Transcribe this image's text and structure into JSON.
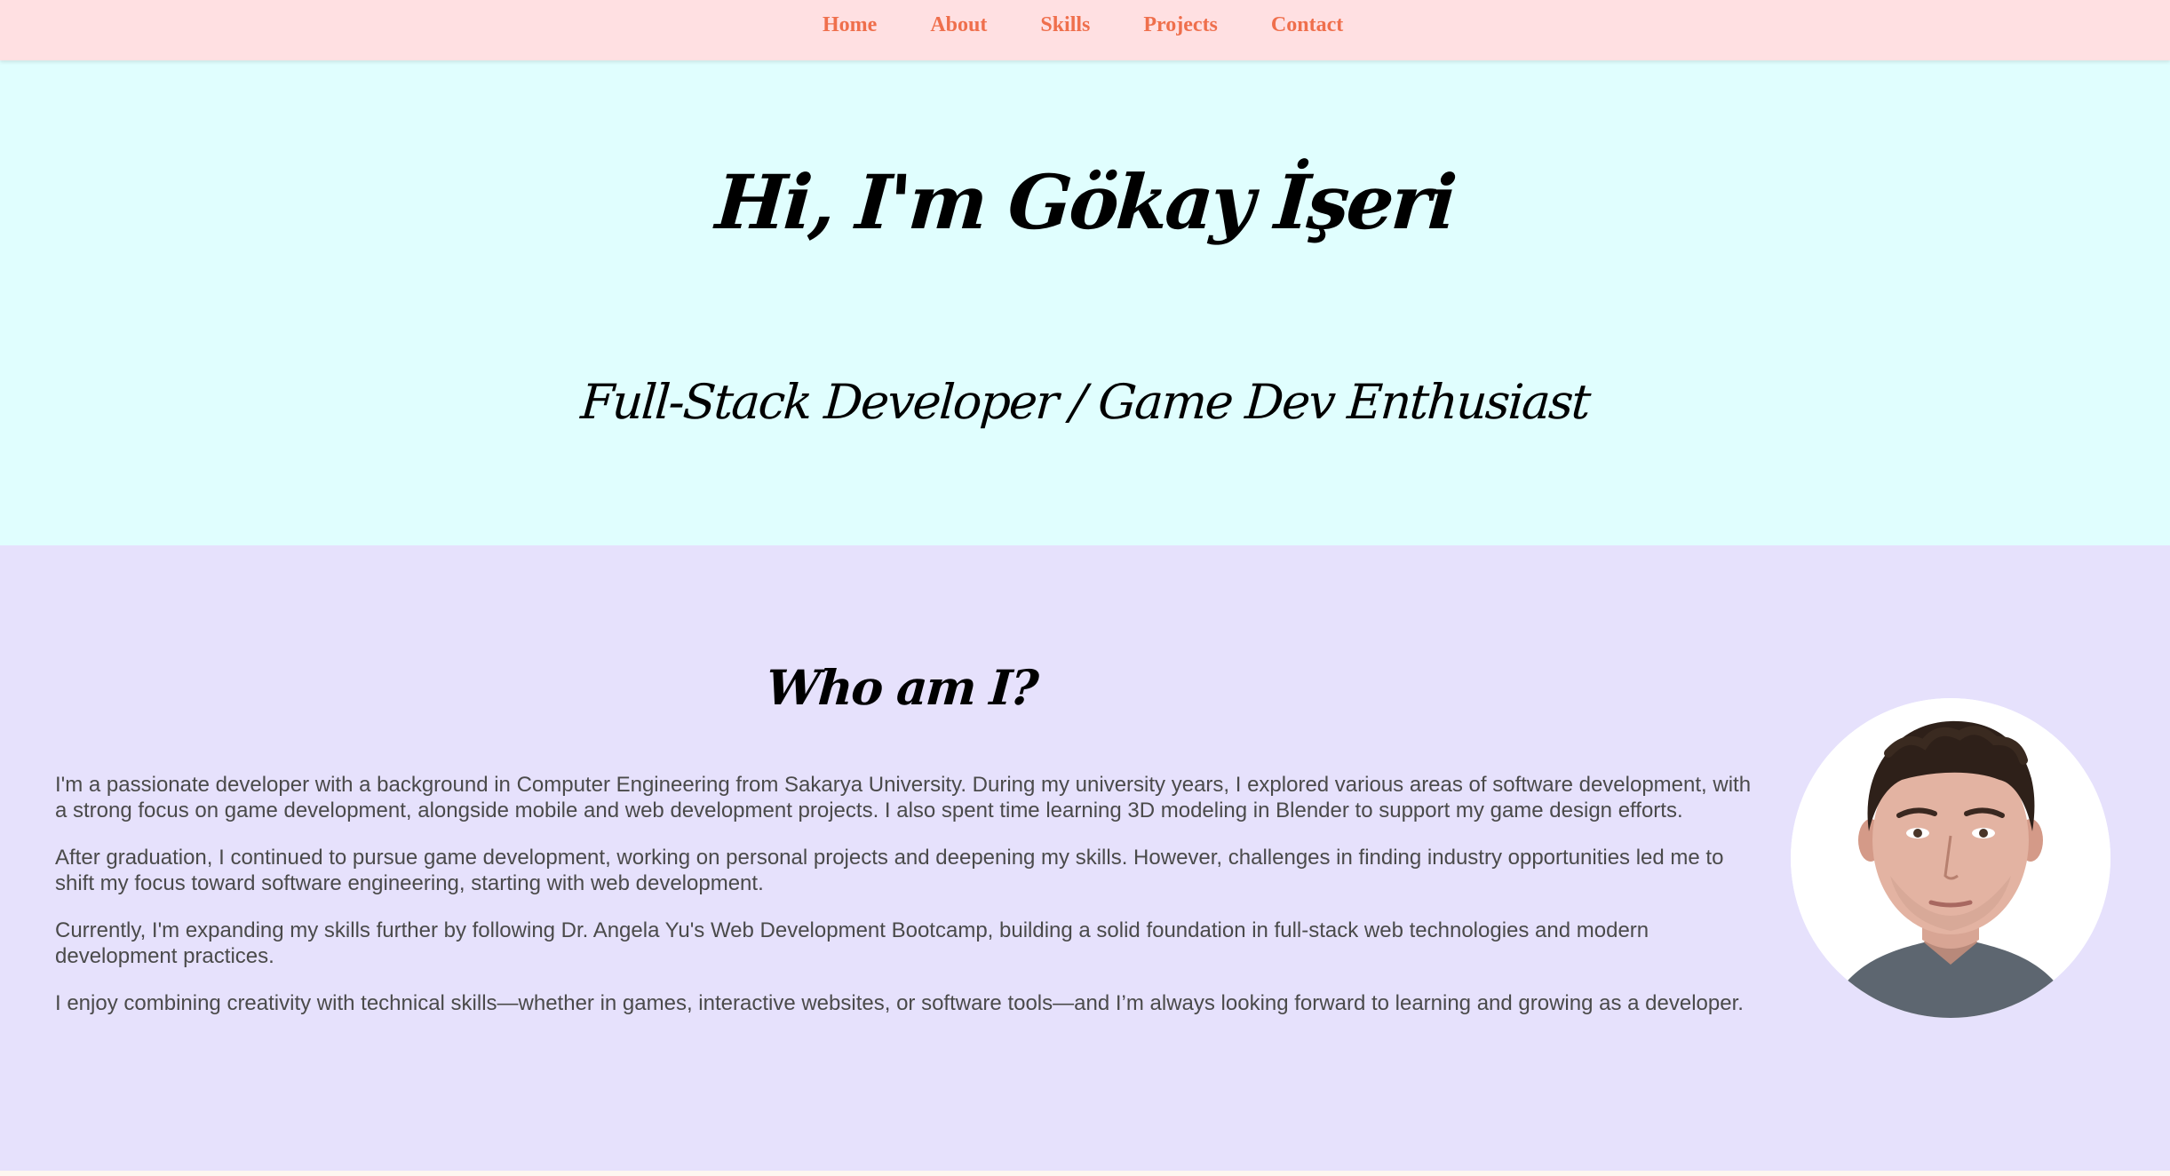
{
  "nav": {
    "items": [
      {
        "label": "Home"
      },
      {
        "label": "About"
      },
      {
        "label": "Skills"
      },
      {
        "label": "Projects"
      },
      {
        "label": "Contact"
      }
    ]
  },
  "hero": {
    "title": "Hi, I'm Gökay İşeri",
    "subtitle": "Full-Stack Developer / Game Dev Enthusiast"
  },
  "about": {
    "heading": "Who am I?",
    "paragraphs": [
      "I'm a passionate developer with a background in Computer Engineering from Sakarya University. During my university years, I explored various areas of software development, with a strong focus on game development, alongside mobile and web development projects. I also spent time learning 3D modeling in Blender to support my game design efforts.",
      "After graduation, I continued to pursue game development, working on personal projects and deepening my skills. However, challenges in finding industry opportunities led me to shift my focus toward software engineering, starting with web development.",
      "Currently, I'm expanding my skills further by following Dr. Angela Yu's Web Development Bootcamp, building a solid foundation in full-stack web technologies and modern development practices.",
      "I enjoy combining creativity with technical skills—whether in games, interactive websites, or software tools—and I’m always looking forward to learning and growing as a developer."
    ],
    "photo_icon": "profile-photo"
  },
  "colors": {
    "nav_background": "#ffe0e2",
    "nav_link": "#ef6f4c",
    "hero_background": "#e0fefe",
    "about_background": "#e6e1fc",
    "body_text": "#4a4a4a"
  }
}
